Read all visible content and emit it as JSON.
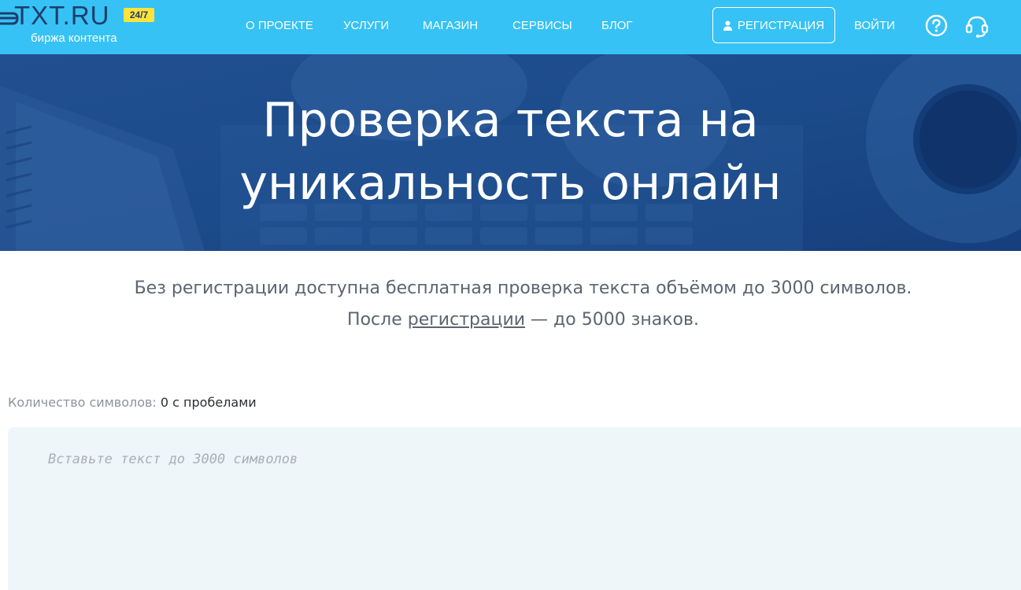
{
  "header": {
    "logo": {
      "text": "TXT.RU",
      "badge": "24/7",
      "subtitle": "биржа контента"
    },
    "nav": [
      {
        "label": "О проекте"
      },
      {
        "label": "Услуги"
      },
      {
        "label": "Магазин"
      },
      {
        "label": "Сервисы"
      },
      {
        "label": "Блог"
      }
    ],
    "register_label": "РЕГИСТРАЦИЯ",
    "login_label": "ВОЙТИ",
    "icons": {
      "help": "question-circle-icon",
      "support": "headset-icon",
      "register": "user-icon"
    },
    "colors": {
      "background": "#36c2f4",
      "badge": "#ffe33b",
      "logo_text": "#1f3d6b"
    }
  },
  "hero": {
    "title_line1": "Проверка текста на",
    "title_line2": "уникальность онлайн",
    "background_color": "#1a4a8a"
  },
  "intro": {
    "line1": "Без регистрации доступна бесплатная проверка текста объёмом до 3000 символов.",
    "line2_before": "После ",
    "line2_link": "регистрации",
    "line2_after": " — до 5000 знаков."
  },
  "counter": {
    "label": "Количество символов:",
    "value": "0 с пробелами"
  },
  "editor": {
    "placeholder": "Вставьте текст до 3000 символов",
    "value": "",
    "background_color": "#eff6fa"
  }
}
